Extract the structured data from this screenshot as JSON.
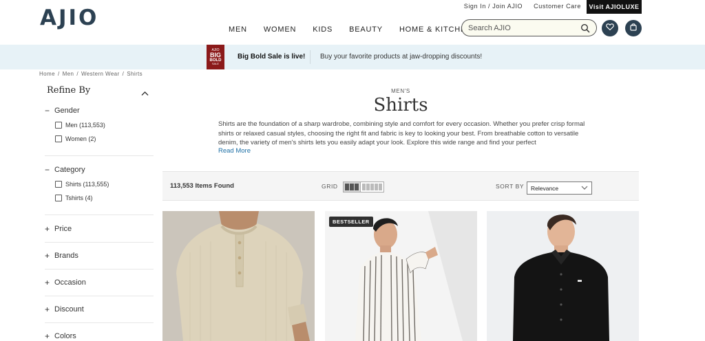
{
  "header": {
    "logo": "AJIO",
    "signin": "Sign In / Join AJIO",
    "customer_care": "Customer Care",
    "luxe": "Visit AJIOLUXE",
    "nav": [
      "MEN",
      "WOMEN",
      "KIDS",
      "BEAUTY",
      "HOME & KITCHEN"
    ],
    "search_placeholder": "Search AJIO",
    "icons": [
      "search-icon",
      "heart-icon",
      "bag-icon"
    ]
  },
  "promo": {
    "badge": [
      "AJIO",
      "BIG",
      "BOLD",
      "SALE"
    ],
    "title": "Big Bold Sale is live!",
    "text": "Buy your favorite products at jaw-dropping discounts!"
  },
  "breadcrumb": [
    "Home",
    "/",
    "Men",
    "/",
    "Western Wear",
    "/",
    "Shirts"
  ],
  "sidebar": {
    "title": "Refine By",
    "gender": {
      "title": "Gender",
      "options": [
        "Men (113,553)",
        "Women (2)"
      ]
    },
    "category": {
      "title": "Category",
      "options": [
        "Shirts (113,555)",
        "Tshirts (4)"
      ]
    },
    "collapsed": [
      "Price",
      "Brands",
      "Occasion",
      "Discount",
      "Colors"
    ],
    "collapsed_sign": "+",
    "expanded_sign": "−"
  },
  "main": {
    "kicker": "MEN'S",
    "title": "Shirts",
    "description": "Shirts are the foundation of a sharp wardrobe, combining style and comfort for every occasion. Whether you prefer crisp formal shirts or relaxed casual styles, choosing the right fit and fabric is key to looking your best. From breathable cotton to versatile denim, the variety of men's shirts lets you easily adapt your look. Explore this wide range and find your perfect",
    "read_more": "Read More",
    "items_found": "113,553 Items Found",
    "grid_label": "GRID",
    "sort_label": "SORT BY",
    "sort_value": "Relevance"
  },
  "products": [
    {
      "badge": "",
      "shirt_color": "#d9cfb6"
    },
    {
      "badge": "BESTSELLER",
      "shirt_color": "#f2f0ec"
    },
    {
      "badge": "",
      "shirt_color": "#151515"
    }
  ],
  "colors": {
    "brand": "#2c4152",
    "promo_bg": "#e7f2f7",
    "link": "#1d6fa5",
    "sale_red": "#8b1a1a"
  }
}
